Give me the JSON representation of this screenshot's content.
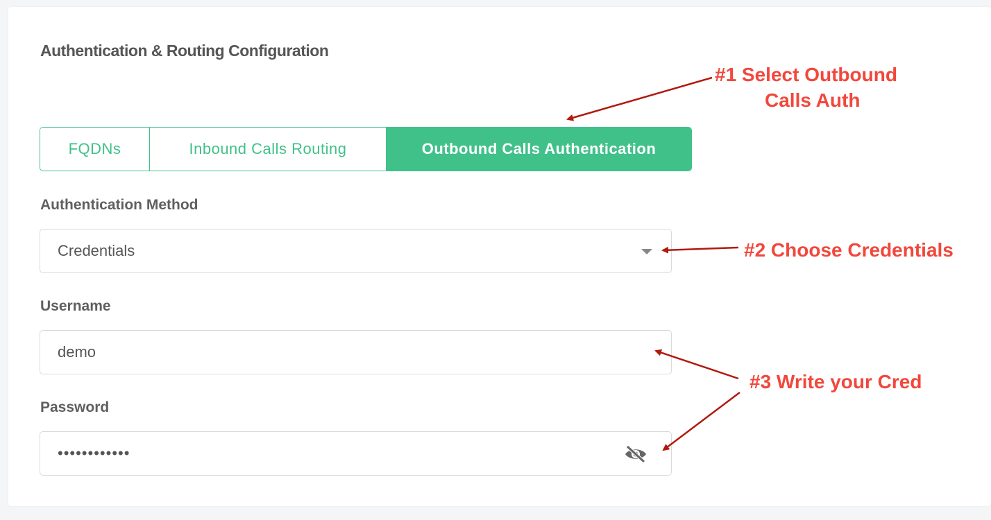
{
  "section": {
    "title": "Authentication & Routing Configuration"
  },
  "tabs": [
    {
      "label": "FQDNs",
      "active": false
    },
    {
      "label": "Inbound Calls Routing",
      "active": false
    },
    {
      "label": "Outbound Calls Authentication",
      "active": true
    }
  ],
  "auth_method": {
    "label": "Authentication Method",
    "value": "Credentials",
    "icon": "chevron-down-icon"
  },
  "username": {
    "label": "Username",
    "value": "demo"
  },
  "password": {
    "label": "Password",
    "value": "••••••••••••",
    "icon": "eye-off-icon"
  },
  "annotations": {
    "step1_line1": "#1 Select Outbound",
    "step1_line2": "Calls Auth",
    "step2": "#2 Choose Credentials",
    "step3": "#3 Write your Cred"
  },
  "colors": {
    "accent": "#41c18a",
    "annotation": "#f2473c",
    "arrow": "#b2190d",
    "background": "#f4f5f7"
  }
}
